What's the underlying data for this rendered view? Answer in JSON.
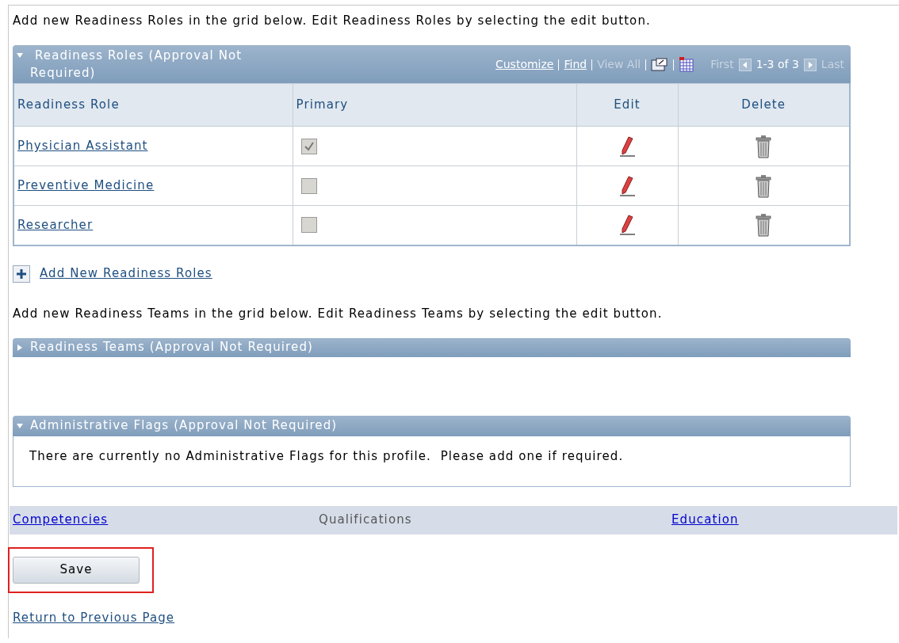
{
  "roles_intro": "Add new Readiness Roles in the grid below. Edit Readiness Roles by selecting the edit button.",
  "roles_grid": {
    "title": "Readiness Roles (Approval Not Required)",
    "expanded": true,
    "toolbar": [
      {
        "kind": "link",
        "label": "Customize"
      },
      {
        "kind": "link",
        "label": "Find"
      },
      {
        "kind": "disabled",
        "label": "View All"
      },
      {
        "kind": "zoom-icon"
      },
      {
        "kind": "grid-icon"
      }
    ],
    "pager": {
      "first": "First",
      "range": "1-3 of 3",
      "last": "Last"
    },
    "columns": [
      "Readiness Role",
      "Primary",
      "Edit",
      "Delete"
    ],
    "rows": [
      {
        "role": "Physician Assistant",
        "primary_checked": true
      },
      {
        "role": "Preventive Medicine",
        "primary_checked": false
      },
      {
        "role": "Researcher",
        "primary_checked": false
      }
    ]
  },
  "add_roles_link": "Add New Readiness Roles",
  "teams_intro": "Add new Readiness Teams in the grid below. Edit Readiness Teams by selecting the edit button.",
  "teams_grid": {
    "title": "Readiness Teams (Approval Not Required)",
    "expanded": false
  },
  "flags_grid": {
    "title": "Administrative Flags (Approval Not Required)",
    "expanded": true,
    "message": "There are currently no Administrative Flags for this profile.  Please add one if required."
  },
  "nav_tabs": [
    {
      "label": "Competencies",
      "selected": false
    },
    {
      "label": "Qualifications",
      "selected": true
    },
    {
      "label": "Education",
      "selected": false
    }
  ],
  "save_button": {
    "label": "Save",
    "highlighted": true
  },
  "return_link": "Return to Previous Page"
}
